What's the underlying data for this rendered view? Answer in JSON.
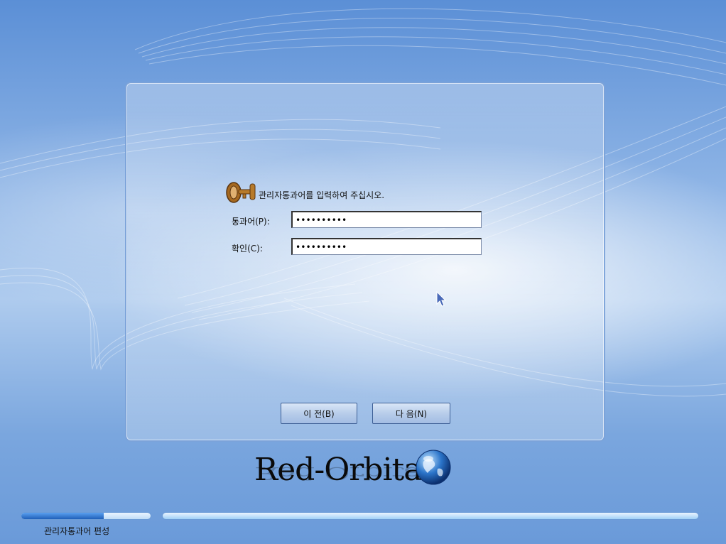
{
  "dialog": {
    "prompt": "관리자통과어를 입력하여 주십시오.",
    "password_label": "통과어(P):",
    "password_value": "••••••••••",
    "confirm_label": "확인(C):",
    "confirm_value": "••••••••••",
    "back_button": "이 전(B)",
    "next_button": "다 음(N)"
  },
  "brand": {
    "logo_text": "Red-Orbita"
  },
  "footer": {
    "status_text": "관리자통과어 편성",
    "progress_fraction": 0.64
  },
  "icons": {
    "key": "key-icon",
    "globe": "globe-icon",
    "cursor": "mouse-pointer-icon"
  },
  "colors": {
    "accent": "#3d5f95",
    "logo_highlight": "#e8e21a"
  }
}
